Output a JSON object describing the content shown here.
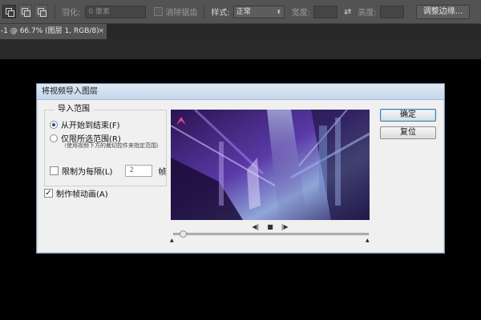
{
  "options_bar": {
    "feather_label": "羽化:",
    "feather_value": "0 像素",
    "antialias_label": "消除锯齿",
    "style_label": "样式:",
    "style_value": "正常",
    "width_label": "宽度:",
    "height_label": "高度:",
    "refine_edge_button": "调整边缘..."
  },
  "document_tab": {
    "title": "-1 @ 66.7% (图层 1, RGB/8)",
    "close_glyph": "×"
  },
  "dialog": {
    "title": "将视频导入图层",
    "range_group_title": "导入范围",
    "radio_start_to_end": "从开始到结束(F)",
    "radio_selected_range": "仅限所选范围(R)",
    "selected_range_note": "（使用视频下方的裁切控件来指定范围）",
    "limit_every_label": "限制为每隔(L)",
    "limit_every_value": "2",
    "frames_unit": "帧",
    "make_frame_animation_label": "制作帧动画(A)",
    "ok_button": "确定",
    "reset_button": "复位",
    "playback_controls": {
      "prev": "◀|",
      "stop": "■",
      "next": "|▶"
    },
    "range_start_marker": "▲",
    "range_end_marker": "▲",
    "radio_start_to_end_selected": true,
    "limit_every_checked": false,
    "make_frame_animation_checked": true,
    "scrub_position": 0.03
  },
  "colors": {
    "dialog_bg": "#f0f0f0",
    "titlebar_top": "#dfe9f5",
    "titlebar_bottom": "#c6d6ec",
    "canvas": "#000000",
    "toolbar": "#535353",
    "preview_accent": "#7a4fd6"
  }
}
